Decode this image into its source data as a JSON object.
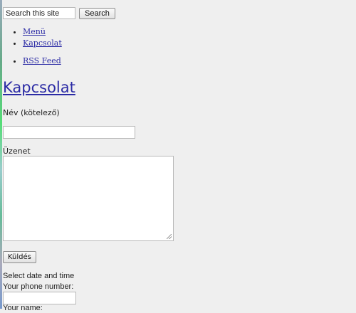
{
  "search": {
    "value": "Search this site",
    "button_label": "Search"
  },
  "menu": {
    "items": [
      {
        "label": "Menü"
      },
      {
        "label": "Kapcsolat"
      }
    ],
    "feed": {
      "label": "RSS Feed"
    }
  },
  "page": {
    "title": "Kapcsolat"
  },
  "form": {
    "name_label": "Név (kötelező)",
    "name_value": "",
    "message_label": "Üzenet",
    "message_value": "",
    "submit_label": "Küldés",
    "date_label": "Select date and time",
    "phone_label": "Your phone number:",
    "phone_value": "",
    "your_name_label": "Your name:"
  }
}
